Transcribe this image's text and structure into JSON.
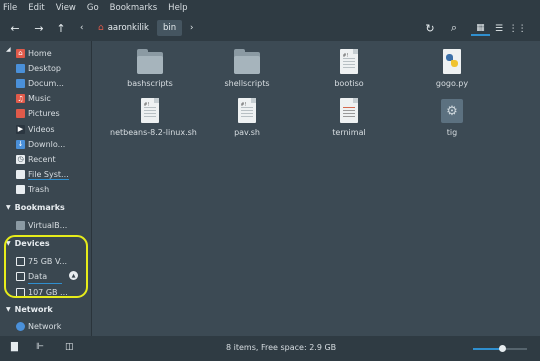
{
  "menu": [
    "File",
    "Edit",
    "View",
    "Go",
    "Bookmarks",
    "Help"
  ],
  "toolbar": {
    "back": "←",
    "forward": "→",
    "up": "↑",
    "crumb_prev": "‹",
    "crumb_home": "aaronkilik",
    "crumb_current": "bin",
    "crumb_next": "›",
    "reload": "↻",
    "search": "⌕",
    "view_icons": "▦",
    "view_list": "☰",
    "view_compact": "⋮⋮"
  },
  "sidebar": {
    "places": [
      {
        "label": "Home",
        "icon": "home-icon",
        "glyph": "⌂",
        "color": "#e05a4a"
      },
      {
        "label": "Desktop",
        "icon": "desktop-icon",
        "glyph": "",
        "color": "#4a90d9"
      },
      {
        "label": "Docum...",
        "icon": "documents-icon",
        "glyph": "",
        "color": "#4a90d9"
      },
      {
        "label": "Music",
        "icon": "music-icon",
        "glyph": "♫",
        "color": "#e05a4a"
      },
      {
        "label": "Pictures",
        "icon": "pictures-icon",
        "glyph": "",
        "color": "#e05a4a"
      },
      {
        "label": "Videos",
        "icon": "videos-icon",
        "glyph": "▶",
        "color": "#2b3640"
      },
      {
        "label": "Downlo...",
        "icon": "downloads-icon",
        "glyph": "↓",
        "color": "#4a90d9"
      },
      {
        "label": "Recent",
        "icon": "recent-icon",
        "glyph": "◷",
        "color": "#e8edf0"
      },
      {
        "label": "File Syst...",
        "icon": "drive-icon",
        "glyph": "",
        "color": "#e8edf0"
      },
      {
        "label": "Trash",
        "icon": "trash-icon",
        "glyph": "",
        "color": "#e8edf0"
      }
    ],
    "bookmarks_title": "Bookmarks",
    "bookmarks": [
      {
        "label": "VirtualB...",
        "icon": "folder-icon"
      }
    ],
    "devices_title": "Devices",
    "devices": [
      {
        "label": "75 GB V..."
      },
      {
        "label": "Data"
      },
      {
        "label": "107 GB ..."
      }
    ],
    "network_title": "Network",
    "network": [
      {
        "label": "Network"
      }
    ]
  },
  "files": [
    {
      "name": "bashscripts",
      "type": "folder"
    },
    {
      "name": "shellscripts",
      "type": "folder"
    },
    {
      "name": "bootiso",
      "type": "script"
    },
    {
      "name": "gogo.py",
      "type": "python"
    },
    {
      "name": "netbeans-8.2-linux.sh",
      "type": "script"
    },
    {
      "name": "pav.sh",
      "type": "script"
    },
    {
      "name": "ternimal",
      "type": "text"
    },
    {
      "name": "tig",
      "type": "binary"
    }
  ],
  "status": {
    "text": "8 items, Free space: 2.9 GB",
    "zoom_fraction": 0.55
  },
  "colors": {
    "accent": "#2f8fcf",
    "highlight": "#e6ec1a"
  }
}
